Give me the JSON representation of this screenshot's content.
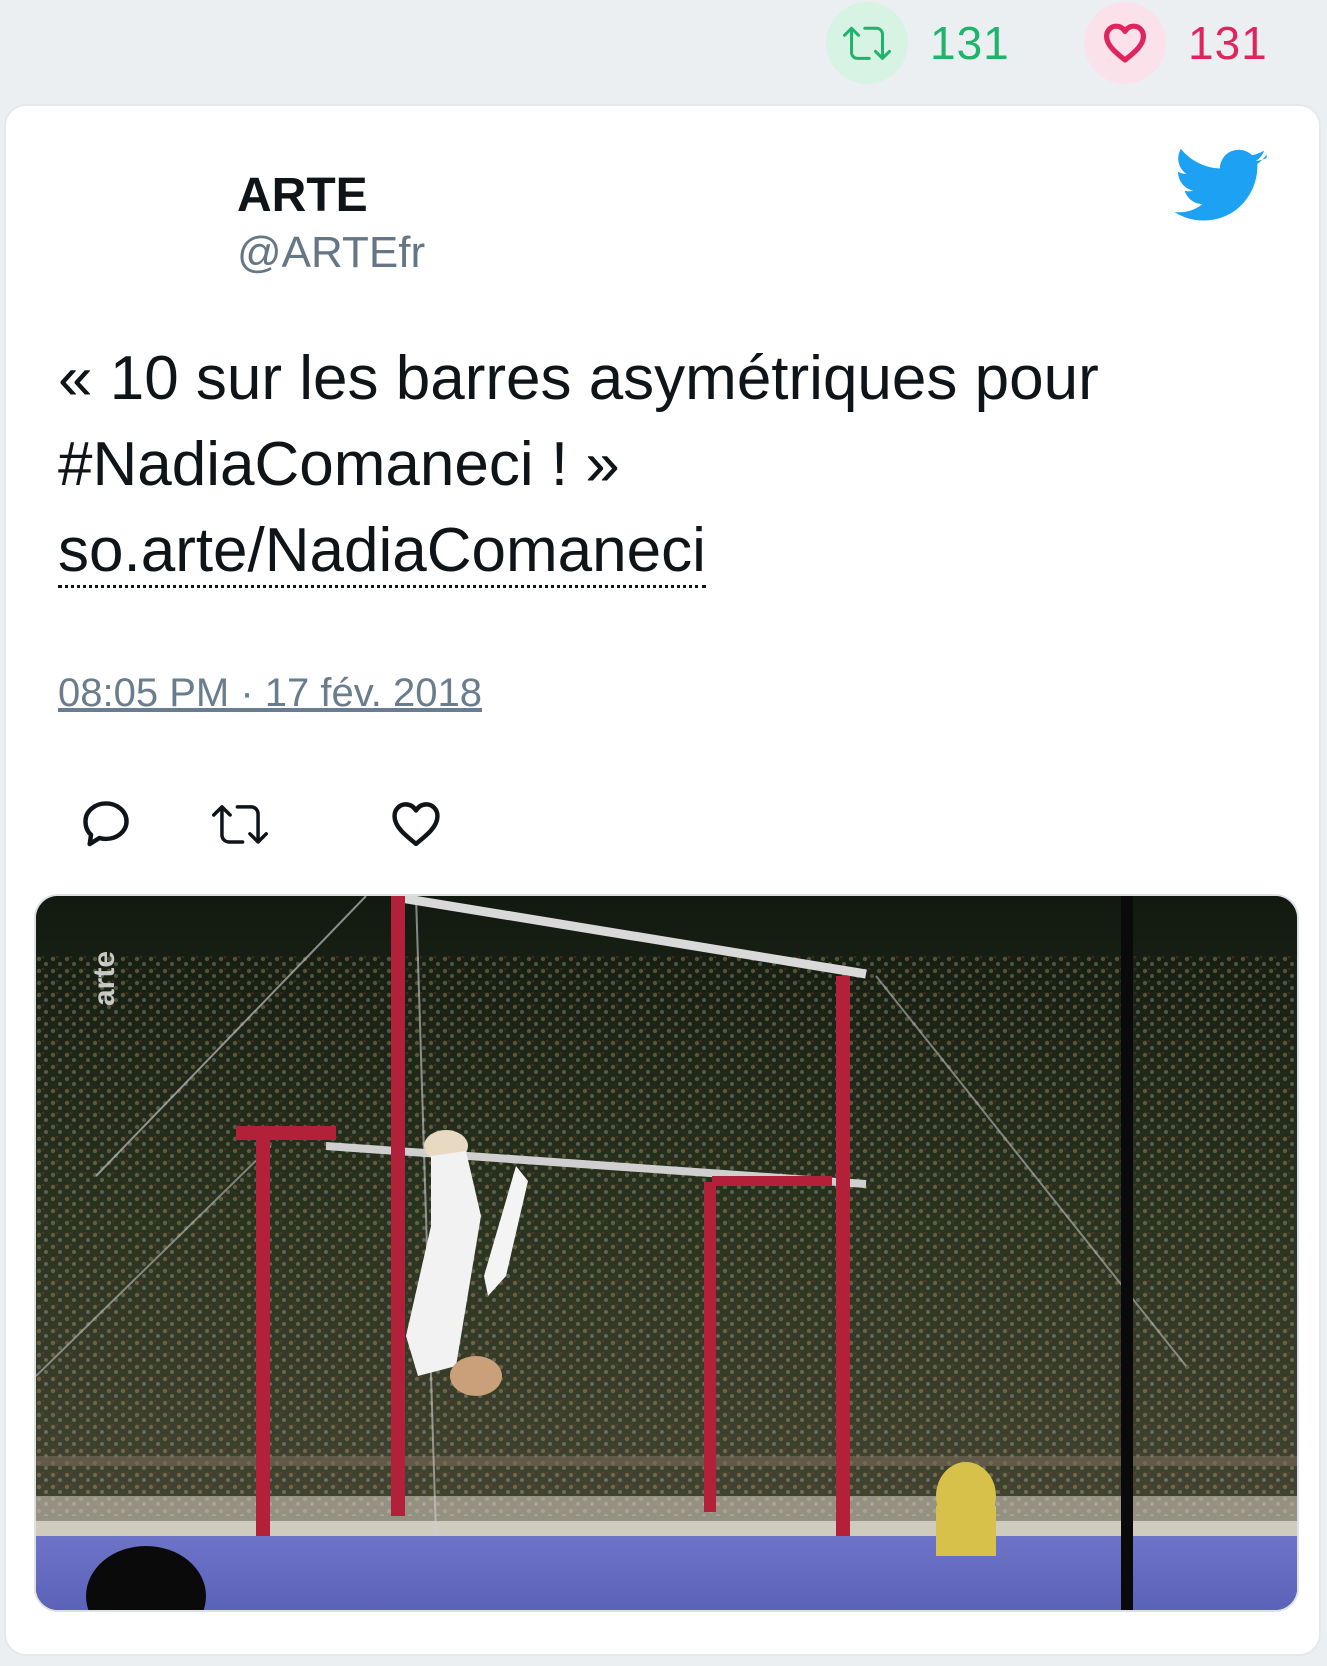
{
  "stats": {
    "retweets": {
      "icon": "retweet-icon",
      "count": "131",
      "color": "#1fb36b"
    },
    "likes": {
      "icon": "heart-icon",
      "count": "131",
      "color": "#e0245e"
    }
  },
  "tweet": {
    "author_name": "ARTE",
    "author_handle": "@ARTEfr",
    "text_line1": "« 10 sur les barres asymétriques pour",
    "text_line2": "#NadiaComaneci ! »",
    "link_text": "so.arte/NadiaComaneci",
    "timestamp": "08:05 PM · 17 fév. 2018",
    "brand_icon": "twitter-bird-icon",
    "brand_color": "#1da1f2"
  },
  "actions": [
    {
      "name": "reply",
      "icon": "reply-icon"
    },
    {
      "name": "retweet",
      "icon": "retweet-icon"
    },
    {
      "name": "like",
      "icon": "heart-icon"
    }
  ],
  "media": {
    "description_icon": "video-thumbnail",
    "watermark": "arte"
  }
}
